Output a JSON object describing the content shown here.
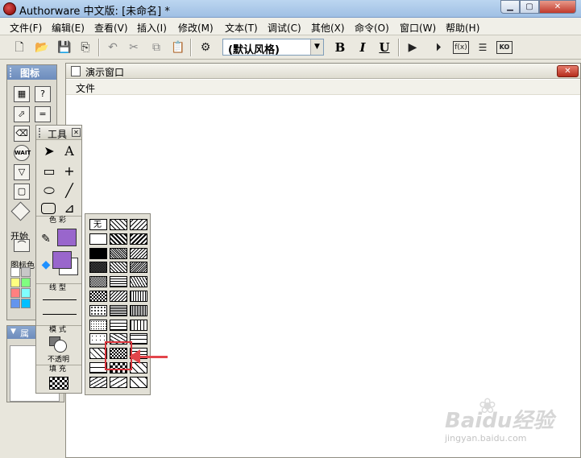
{
  "window": {
    "title": "Authorware 中文版: [未命名] *",
    "minimize_icon": "minimize-icon",
    "maximize_icon": "maximize-icon",
    "close_icon": "close-icon"
  },
  "menubar": {
    "items": [
      "文件(F)",
      "编辑(E)",
      "查看(V)",
      "插入(I)",
      "修改(M)",
      "文本(T)",
      "调试(C)",
      "其他(X)",
      "命令(O)",
      "窗口(W)",
      "帮助(H)"
    ]
  },
  "toolbar": {
    "style_select_value": "(默认风格)",
    "bold_label": "B",
    "italic_label": "I",
    "underline_label": "U",
    "glyphs": {
      "new": "🗋",
      "open": "📂",
      "save": "💾",
      "import": "⎘",
      "undo": "↶",
      "cut": "✂",
      "copy": "⧉",
      "paste": "📋",
      "find": "⚙",
      "run": "▶",
      "control": "⏵",
      "fx": "f(x)",
      "vars": "☰",
      "ko": "KO"
    }
  },
  "presentation_window": {
    "title": "演示窗口",
    "menu_file": "文件"
  },
  "icon_palette": {
    "title": "图标",
    "start_label": "开始",
    "icon_color_label": "图标色",
    "icons": [
      "display-icon",
      "interaction-icon",
      "motion-icon",
      "calculate-icon",
      "erase-icon",
      "map-icon",
      "wait-icon",
      "digital-movie-icon",
      "navigate-icon",
      "sound-icon",
      "framework-icon",
      "video-icon",
      "decision-icon",
      "knowledge-object-icon"
    ],
    "swatch_colors": [
      "#ffffff",
      "#c8c8c8",
      "#ffff80",
      "#80ff80",
      "#ff8080",
      "#80ffff",
      "#c080ff",
      "#ffc080",
      "#6495ed",
      "#00bfff"
    ]
  },
  "properties_panel": {
    "title": "属"
  },
  "tool_palette": {
    "title": "工具",
    "color_label": "色彩",
    "line_label": "线型",
    "mode_label": "模式",
    "mode_value": "不透明",
    "fill_label": "填充",
    "colors": {
      "line_color": "#9966cc",
      "fill_fore_color": "#9966cc",
      "fill_back_color": "#ffffff"
    }
  },
  "fill_popup": {
    "none_label": "无",
    "selected_index": 31,
    "highlight_color": "#d9333a"
  },
  "watermark": {
    "brand": "Bai",
    "brand_suffix": "经验",
    "url": "jingyan.baidu.com"
  }
}
